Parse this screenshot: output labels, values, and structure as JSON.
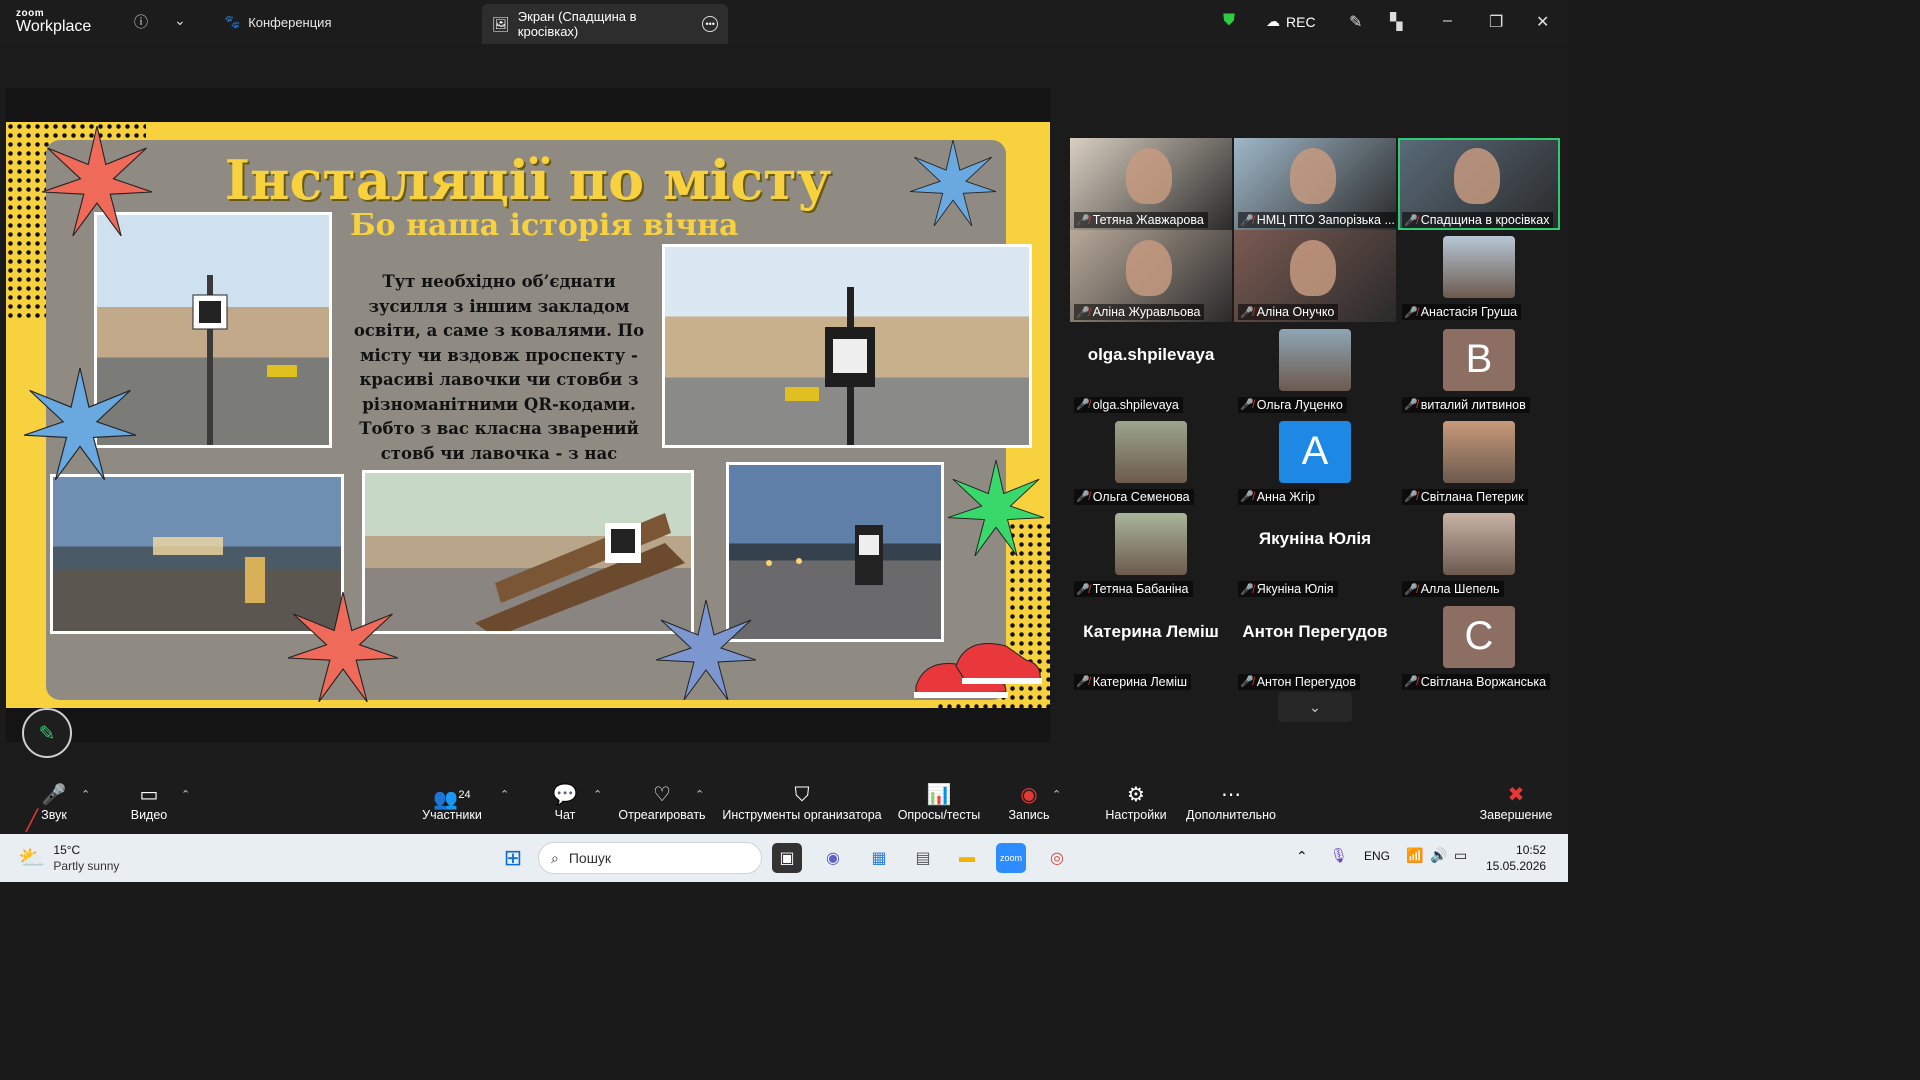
{
  "app": {
    "logo_top": "zoom",
    "logo_bottom": "Workplace"
  },
  "topbar": {
    "conference_tab": "Конференция",
    "screen_tab": "Экран (Спадщина в кросівках)",
    "rec_label": "REC"
  },
  "slide": {
    "title": "Інсталяції по місту",
    "subtitle": "Бо наша історія вічна",
    "body": "Тут необхідно об’єднати зусилля з іншим закладом освіти, а саме з ковалями. По місту чи вздовж проспекту - красиві лавочки чи стовби з різноманітними QR-кодами. Тобто з вас класна зварений стовб чи лавочка  - з нас цікава історія."
  },
  "participants": [
    {
      "name": "Тетяна Жавжарова",
      "kind": "video",
      "color": "#d9cfc1"
    },
    {
      "name": "НМЦ ПТО Запорізька ...",
      "kind": "video",
      "color": "#9fb7c8"
    },
    {
      "name": "Спадщина в кросівках",
      "kind": "video",
      "color": "#5a6b7a",
      "active": true
    },
    {
      "name": "Аліна Журавльова",
      "kind": "video",
      "color": "#b8a99a"
    },
    {
      "name": "Аліна Онучко",
      "kind": "video",
      "color": "#7a5a52"
    },
    {
      "name": "Анастасія Груша",
      "kind": "avatar",
      "color": "#b7c7d6"
    },
    {
      "name": "olga.shpilevaya",
      "kind": "text",
      "big": "olga.shpilevaya"
    },
    {
      "name": "Ольга Луценко",
      "kind": "avatar",
      "color": "#8ea5b5"
    },
    {
      "name": "виталий литвинов",
      "kind": "letter",
      "letter": "B",
      "color": "#8d6e63"
    },
    {
      "name": "Ольга Семенова",
      "kind": "avatar",
      "color": "#9aa58c"
    },
    {
      "name": "Анна Жгір",
      "kind": "letter",
      "letter": "A",
      "color": "#1e88e5"
    },
    {
      "name": "Світлана Петерик",
      "kind": "avatar",
      "color": "#c79a7a"
    },
    {
      "name": "Тетяна Бабаніна",
      "kind": "avatar",
      "color": "#a9b59a"
    },
    {
      "name": "Якуніна Юлія",
      "kind": "text",
      "big": "Якуніна Юлія"
    },
    {
      "name": "Алла Шепель",
      "kind": "avatar",
      "color": "#c8b3a6"
    },
    {
      "name": "Катерина Леміш",
      "kind": "text",
      "big": "Катерина Леміш"
    },
    {
      "name": "Антон Перегудов",
      "kind": "text",
      "big": "Антон Перегудов"
    },
    {
      "name": "Світлана Воржанська",
      "kind": "letter",
      "letter": "C",
      "color": "#8d6e63"
    }
  ],
  "toolbar": {
    "audio": "Звук",
    "video": "Видео",
    "participants": "Участники",
    "participants_count": "24",
    "chat": "Чат",
    "react": "Отреагировать",
    "host_tools": "Инструменты организатора",
    "polls": "Опросы/тесты",
    "record": "Запись",
    "settings": "Настройки",
    "more": "Дополнительно",
    "end": "Завершение"
  },
  "taskbar": {
    "temp": "15°C",
    "weather": "Partly sunny",
    "search_placeholder": "Пошук",
    "lang": "ENG",
    "time": "10:52",
    "date": "15.05.2026"
  }
}
